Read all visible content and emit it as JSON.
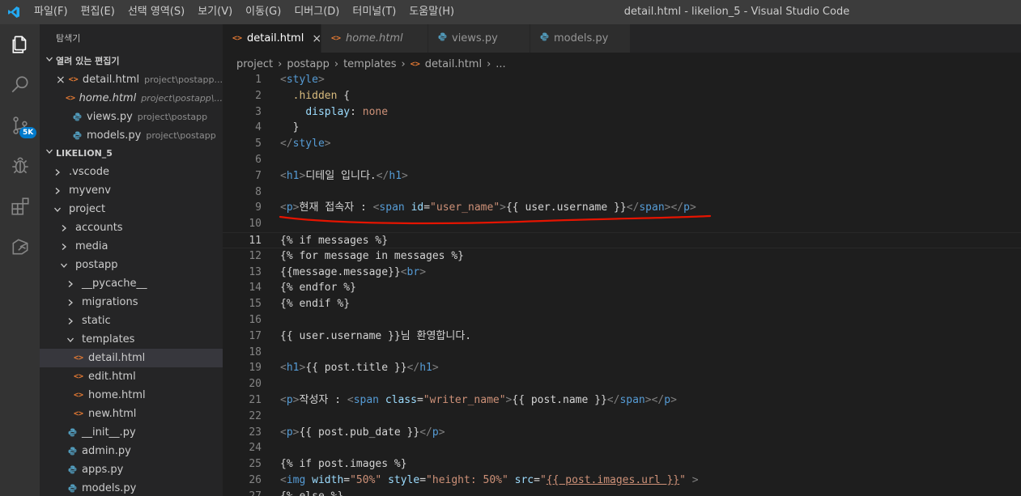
{
  "menu": [
    "파일(F)",
    "편집(E)",
    "선택 영역(S)",
    "보기(V)",
    "이동(G)",
    "디버그(D)",
    "터미널(T)",
    "도움말(H)"
  ],
  "window_title": "detail.html - likelion_5 - Visual Studio Code",
  "activity": {
    "source_control_badge": "5K"
  },
  "sidebar": {
    "title": "탐색기",
    "open_editors_header": "열려 있는 편집기",
    "open_editors": [
      {
        "name": "detail.html",
        "path": "project\\postapp...",
        "icon": "html",
        "close": "×"
      },
      {
        "name": "home.html",
        "path": "project\\postapp\\...",
        "icon": "html"
      },
      {
        "name": "views.py",
        "path": "project\\postapp",
        "icon": "python"
      },
      {
        "name": "models.py",
        "path": "project\\postapp",
        "icon": "python"
      }
    ],
    "workspace_header": "LIKELION_5",
    "tree": [
      {
        "label": ".vscode"
      },
      {
        "label": "myvenv"
      },
      {
        "label": "project"
      },
      {
        "label": "accounts"
      },
      {
        "label": "media"
      },
      {
        "label": "postapp"
      },
      {
        "label": "__pycache__"
      },
      {
        "label": "migrations"
      },
      {
        "label": "static"
      },
      {
        "label": "templates"
      },
      {
        "label": "detail.html"
      },
      {
        "label": "edit.html"
      },
      {
        "label": "home.html"
      },
      {
        "label": "new.html"
      },
      {
        "label": "__init__.py"
      },
      {
        "label": "admin.py"
      },
      {
        "label": "apps.py"
      },
      {
        "label": "models.py"
      }
    ]
  },
  "tabs": [
    {
      "label": "detail.html",
      "icon": "html",
      "close": "×"
    },
    {
      "label": "home.html",
      "icon": "html"
    },
    {
      "label": "views.py",
      "icon": "python"
    },
    {
      "label": "models.py",
      "icon": "python"
    }
  ],
  "breadcrumb": [
    "project",
    "postapp",
    "templates",
    "detail.html",
    "..."
  ],
  "editor": {
    "current_line": 11,
    "lines": [
      {
        "n": "1",
        "tokens": [
          [
            "t-tag",
            "<"
          ],
          [
            "t-name",
            "style"
          ],
          [
            "t-tag",
            ">"
          ]
        ]
      },
      {
        "n": "2",
        "tokens": [
          [
            "t-txt",
            "  "
          ],
          [
            "t-sel",
            ".hidden"
          ],
          [
            "t-txt",
            " {"
          ]
        ]
      },
      {
        "n": "3",
        "tokens": [
          [
            "t-txt",
            "    "
          ],
          [
            "t-prop",
            "display"
          ],
          [
            "t-txt",
            ": "
          ],
          [
            "t-val",
            "none"
          ]
        ]
      },
      {
        "n": "4",
        "tokens": [
          [
            "t-txt",
            "  }"
          ]
        ]
      },
      {
        "n": "5",
        "tokens": [
          [
            "t-tag",
            "</"
          ],
          [
            "t-name",
            "style"
          ],
          [
            "t-tag",
            ">"
          ]
        ]
      },
      {
        "n": "6",
        "tokens": []
      },
      {
        "n": "7",
        "tokens": [
          [
            "t-tag",
            "<"
          ],
          [
            "t-name",
            "h1"
          ],
          [
            "t-tag",
            ">"
          ],
          [
            "t-txt",
            "디테일 입니다."
          ],
          [
            "t-tag",
            "</"
          ],
          [
            "t-name",
            "h1"
          ],
          [
            "t-tag",
            ">"
          ]
        ]
      },
      {
        "n": "8",
        "tokens": []
      },
      {
        "n": "9",
        "tokens": [
          [
            "t-tag",
            "<"
          ],
          [
            "t-name",
            "p"
          ],
          [
            "t-tag",
            ">"
          ],
          [
            "t-txt",
            "현재 접속자 : "
          ],
          [
            "t-tag",
            "<"
          ],
          [
            "t-name",
            "span"
          ],
          [
            "t-txt",
            " "
          ],
          [
            "t-attr",
            "id"
          ],
          [
            "t-txt",
            "="
          ],
          [
            "t-str",
            "\"user_name\""
          ],
          [
            "t-tag",
            ">"
          ],
          [
            "t-txt",
            "{{ user.username }}"
          ],
          [
            "t-tag",
            "</"
          ],
          [
            "t-name",
            "span"
          ],
          [
            "t-tag",
            "></"
          ],
          [
            "t-name",
            "p"
          ],
          [
            "t-tag",
            ">"
          ]
        ]
      },
      {
        "n": "10",
        "tokens": []
      },
      {
        "n": "11",
        "tokens": [
          [
            "t-txt",
            "{% if messages %}"
          ]
        ]
      },
      {
        "n": "12",
        "tokens": [
          [
            "t-txt",
            "{% for message in messages %}"
          ]
        ]
      },
      {
        "n": "13",
        "tokens": [
          [
            "t-txt",
            "{{message.message}}"
          ],
          [
            "t-tag",
            "<"
          ],
          [
            "t-name",
            "br"
          ],
          [
            "t-tag",
            ">"
          ]
        ]
      },
      {
        "n": "14",
        "tokens": [
          [
            "t-txt",
            "{% endfor %}"
          ]
        ]
      },
      {
        "n": "15",
        "tokens": [
          [
            "t-txt",
            "{% endif %}"
          ]
        ]
      },
      {
        "n": "16",
        "tokens": []
      },
      {
        "n": "17",
        "tokens": [
          [
            "t-txt",
            "{{ user.username }}님 환영합니다."
          ]
        ]
      },
      {
        "n": "18",
        "tokens": []
      },
      {
        "n": "19",
        "tokens": [
          [
            "t-tag",
            "<"
          ],
          [
            "t-name",
            "h1"
          ],
          [
            "t-tag",
            ">"
          ],
          [
            "t-txt",
            "{{ post.title }}"
          ],
          [
            "t-tag",
            "</"
          ],
          [
            "t-name",
            "h1"
          ],
          [
            "t-tag",
            ">"
          ]
        ]
      },
      {
        "n": "20",
        "tokens": []
      },
      {
        "n": "21",
        "tokens": [
          [
            "t-tag",
            "<"
          ],
          [
            "t-name",
            "p"
          ],
          [
            "t-tag",
            ">"
          ],
          [
            "t-txt",
            "작성자 : "
          ],
          [
            "t-tag",
            "<"
          ],
          [
            "t-name",
            "span"
          ],
          [
            "t-txt",
            " "
          ],
          [
            "t-attr",
            "class"
          ],
          [
            "t-txt",
            "="
          ],
          [
            "t-str",
            "\"writer_name\""
          ],
          [
            "t-tag",
            ">"
          ],
          [
            "t-txt",
            "{{ post.name }}"
          ],
          [
            "t-tag",
            "</"
          ],
          [
            "t-name",
            "span"
          ],
          [
            "t-tag",
            "></"
          ],
          [
            "t-name",
            "p"
          ],
          [
            "t-tag",
            ">"
          ]
        ]
      },
      {
        "n": "22",
        "tokens": []
      },
      {
        "n": "23",
        "tokens": [
          [
            "t-tag",
            "<"
          ],
          [
            "t-name",
            "p"
          ],
          [
            "t-tag",
            ">"
          ],
          [
            "t-txt",
            "{{ post.pub_date }}"
          ],
          [
            "t-tag",
            "</"
          ],
          [
            "t-name",
            "p"
          ],
          [
            "t-tag",
            ">"
          ]
        ]
      },
      {
        "n": "24",
        "tokens": []
      },
      {
        "n": "25",
        "tokens": [
          [
            "t-txt",
            "{% if post.images %}"
          ]
        ]
      },
      {
        "n": "26",
        "tokens": [
          [
            "t-tag",
            "<"
          ],
          [
            "t-name",
            "img"
          ],
          [
            "t-txt",
            " "
          ],
          [
            "t-attr",
            "width"
          ],
          [
            "t-txt",
            "="
          ],
          [
            "t-str",
            "\"50%\""
          ],
          [
            "t-txt",
            " "
          ],
          [
            "t-attr",
            "style"
          ],
          [
            "t-txt",
            "="
          ],
          [
            "t-str",
            "\"height: 50%\""
          ],
          [
            "t-txt",
            " "
          ],
          [
            "t-attr",
            "src"
          ],
          [
            "t-txt",
            "="
          ],
          [
            "t-str",
            "\""
          ],
          [
            "t-link",
            "{{ post.images.url }}"
          ],
          [
            "t-str",
            "\""
          ],
          [
            "t-txt",
            " "
          ],
          [
            "t-tag",
            ">"
          ]
        ]
      },
      {
        "n": "27",
        "tokens": [
          [
            "t-txt",
            "{% else %}"
          ]
        ]
      }
    ]
  },
  "colors": {
    "accent": "#007acc",
    "html_icon": "#e37933",
    "python_icon": "#519aba",
    "annotation_underline": "#e51400"
  }
}
